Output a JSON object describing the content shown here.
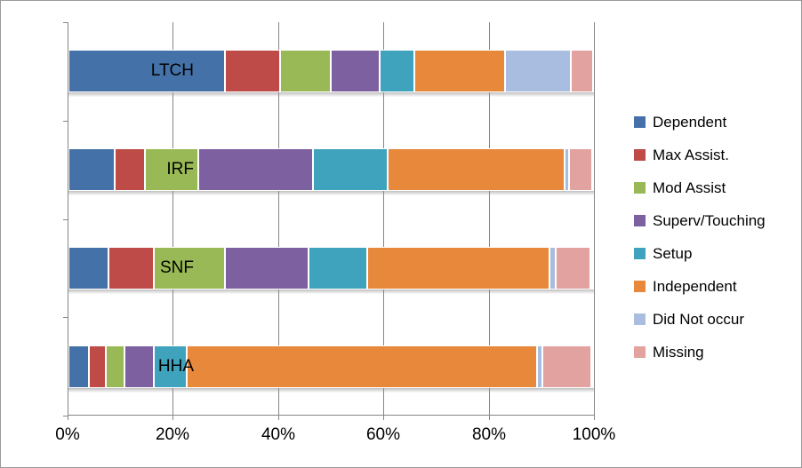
{
  "chart_data": {
    "type": "bar",
    "orientation": "horizontal",
    "stacked": true,
    "stack_mode": "percent",
    "title": "",
    "xlabel": "",
    "ylabel": "",
    "xlim": [
      0,
      100
    ],
    "grid": true,
    "legend_position": "right",
    "categories": [
      "LTCH",
      "IRF",
      "SNF",
      "HHA"
    ],
    "x_tick_labels": [
      "0%",
      "20%",
      "40%",
      "60%",
      "80%",
      "100%"
    ],
    "x_tick_values": [
      0,
      20,
      40,
      60,
      80,
      100
    ],
    "series": [
      {
        "name": "Dependent",
        "color": "#4472A8",
        "values": [
          29.8,
          8.8,
          7.6,
          3.9
        ]
      },
      {
        "name": "Max Assist.",
        "color": "#BE4B48",
        "values": [
          10.4,
          5.7,
          8.7,
          3.2
        ]
      },
      {
        "name": "Mod Assist",
        "color": "#98B955",
        "values": [
          9.6,
          10.2,
          13.5,
          3.5
        ]
      },
      {
        "name": "Superv/Touching",
        "color": "#7D60A0",
        "values": [
          9.4,
          21.8,
          15.8,
          5.6
        ]
      },
      {
        "name": "Setup",
        "color": "#3FA3BE",
        "values": [
          6.5,
          14.1,
          11.1,
          6.3
        ]
      },
      {
        "name": "Independent",
        "color": "#E8883A",
        "values": [
          17.3,
          33.7,
          34.7,
          66.6
        ]
      },
      {
        "name": "Did Not occur",
        "color": "#A8BDE0",
        "values": [
          12.5,
          0.8,
          1.2,
          0.9
        ]
      },
      {
        "name": "Missing",
        "color": "#E2A2A0",
        "values": [
          4.2,
          4.4,
          6.6,
          9.4
        ]
      }
    ]
  },
  "axis": {
    "gridline_color": "#868686",
    "axis_color": "#868686"
  },
  "frame": {
    "border_color": "#9a9a9a",
    "background": "#ffffff"
  }
}
